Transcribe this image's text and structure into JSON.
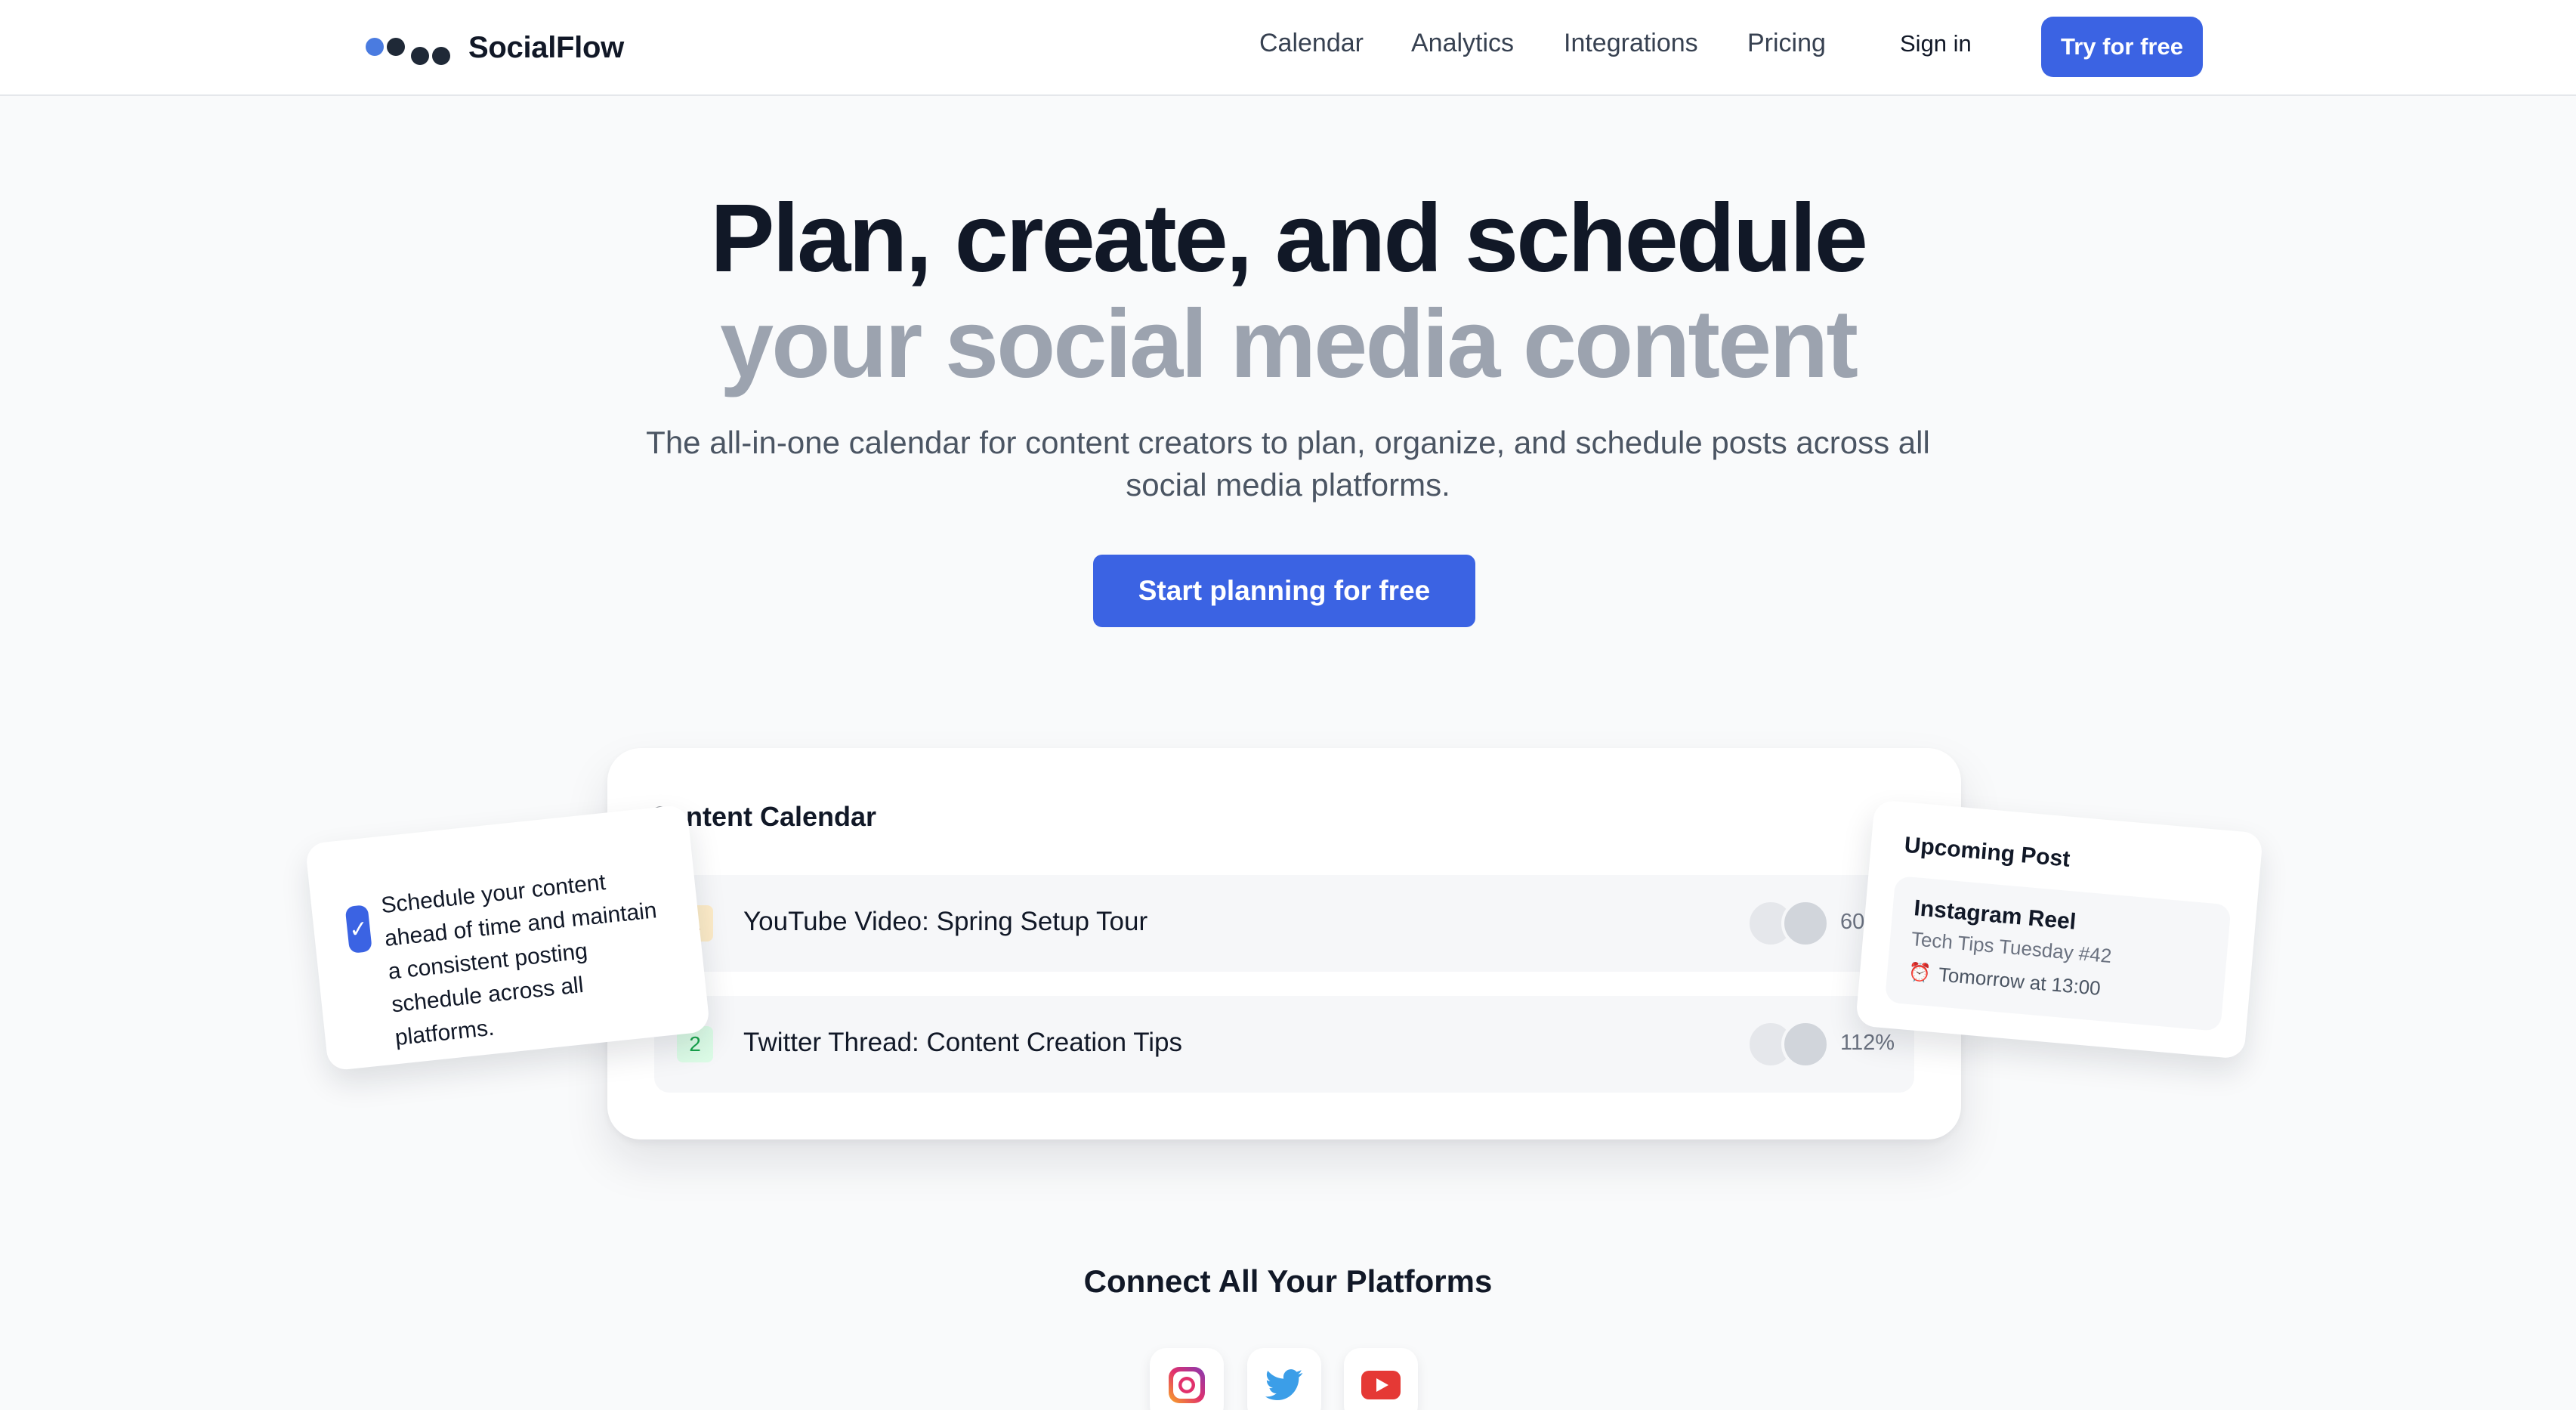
{
  "header": {
    "brand": "SocialFlow",
    "nav": [
      "Calendar",
      "Analytics",
      "Integrations",
      "Pricing"
    ],
    "sign_in": "Sign in",
    "try_free": "Try for free"
  },
  "hero": {
    "line1": "Plan, create, and schedule",
    "line2": "your social media content",
    "subtitle": "The all-in-one calendar for content creators to plan, organize, and schedule posts across all social media platforms.",
    "cta": "Start planning for free"
  },
  "calendar": {
    "title": "Content Calendar",
    "rows": [
      {
        "badge": "1",
        "title": "YouTube Video: Spring Setup Tour",
        "percent": "60%"
      },
      {
        "badge": "2",
        "title": "Twitter Thread: Content Creation Tips",
        "percent": "112%"
      }
    ]
  },
  "tip_card": {
    "text": "Schedule your content ahead of time and maintain a consistent posting schedule across all platforms."
  },
  "upcoming": {
    "title": "Upcoming Post",
    "post_type": "Instagram Reel",
    "post_name": "Tech Tips Tuesday #42",
    "time": "Tomorrow at 13:00"
  },
  "platforms": {
    "title": "Connect All Your Platforms",
    "icons": [
      "instagram-icon",
      "twitter-icon",
      "youtube-icon"
    ]
  },
  "colors": {
    "primary": "#3b63e3",
    "text": "#111827",
    "muted": "#9ca3af",
    "background": "#f9fafb"
  }
}
